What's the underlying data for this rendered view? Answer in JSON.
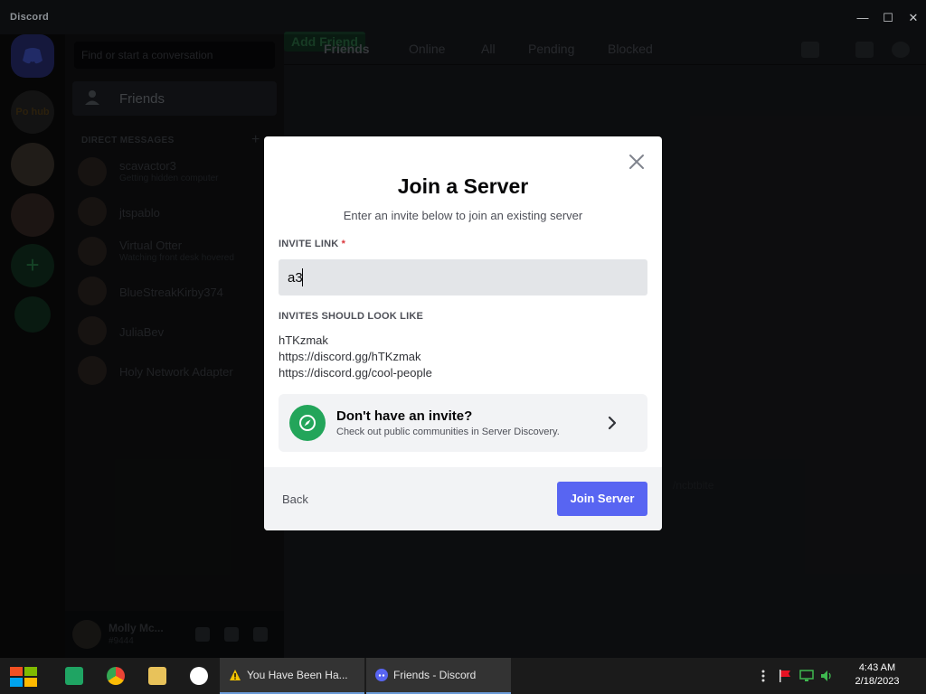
{
  "window": {
    "title": "Discord",
    "controls": {
      "minimize": "—",
      "maximize": "☐",
      "close": "✕"
    }
  },
  "background": {
    "search_placeholder": "Find or start a conversation",
    "friends_label": "Friends",
    "direct_messages_header": "DIRECT MESSAGES",
    "dm_items": [
      {
        "name": "scavactor3",
        "status": "Getting hidden computer"
      },
      {
        "name": "jtspablo",
        "status": ""
      },
      {
        "name": "Virtual Otter",
        "status": "Watching front desk hovered"
      },
      {
        "name": "BlueStreakKirby374",
        "status": ""
      },
      {
        "name": "JuliaBev",
        "status": ""
      },
      {
        "name": "Holy Network Adapter",
        "status": ""
      }
    ],
    "server_ph_label": "Po hub",
    "user": {
      "name": "Molly Mc...",
      "tag": "#9444"
    },
    "topbar": {
      "friends": "Friends",
      "tabs": [
        "Online",
        "All",
        "Pending",
        "Blocked"
      ],
      "add_friend": "Add Friend"
    },
    "main_note": "/ncbtbite"
  },
  "modal": {
    "title": "Join a Server",
    "subtitle": "Enter an invite below to join an existing server",
    "invite_label": "INVITE LINK",
    "required_mark": "*",
    "invite_value": "a3",
    "examples_label": "INVITES SHOULD LOOK LIKE",
    "examples": [
      "hTKzmak",
      "https://discord.gg/hTKzmak",
      "https://discord.gg/cool-people"
    ],
    "discovery_title": "Don't have an invite?",
    "discovery_sub": "Check out public communities in Server Discovery.",
    "back_label": "Back",
    "join_label": "Join Server",
    "accent_color": "#5865f2",
    "discovery_color": "#23a55a"
  },
  "taskbar": {
    "tasks": [
      {
        "title": "You Have Been Ha...",
        "icon": "warning-icon"
      },
      {
        "title": "Friends - Discord",
        "icon": "discord-icon"
      }
    ],
    "clock_time": "4:43 AM",
    "clock_date": "2/18/2023"
  }
}
